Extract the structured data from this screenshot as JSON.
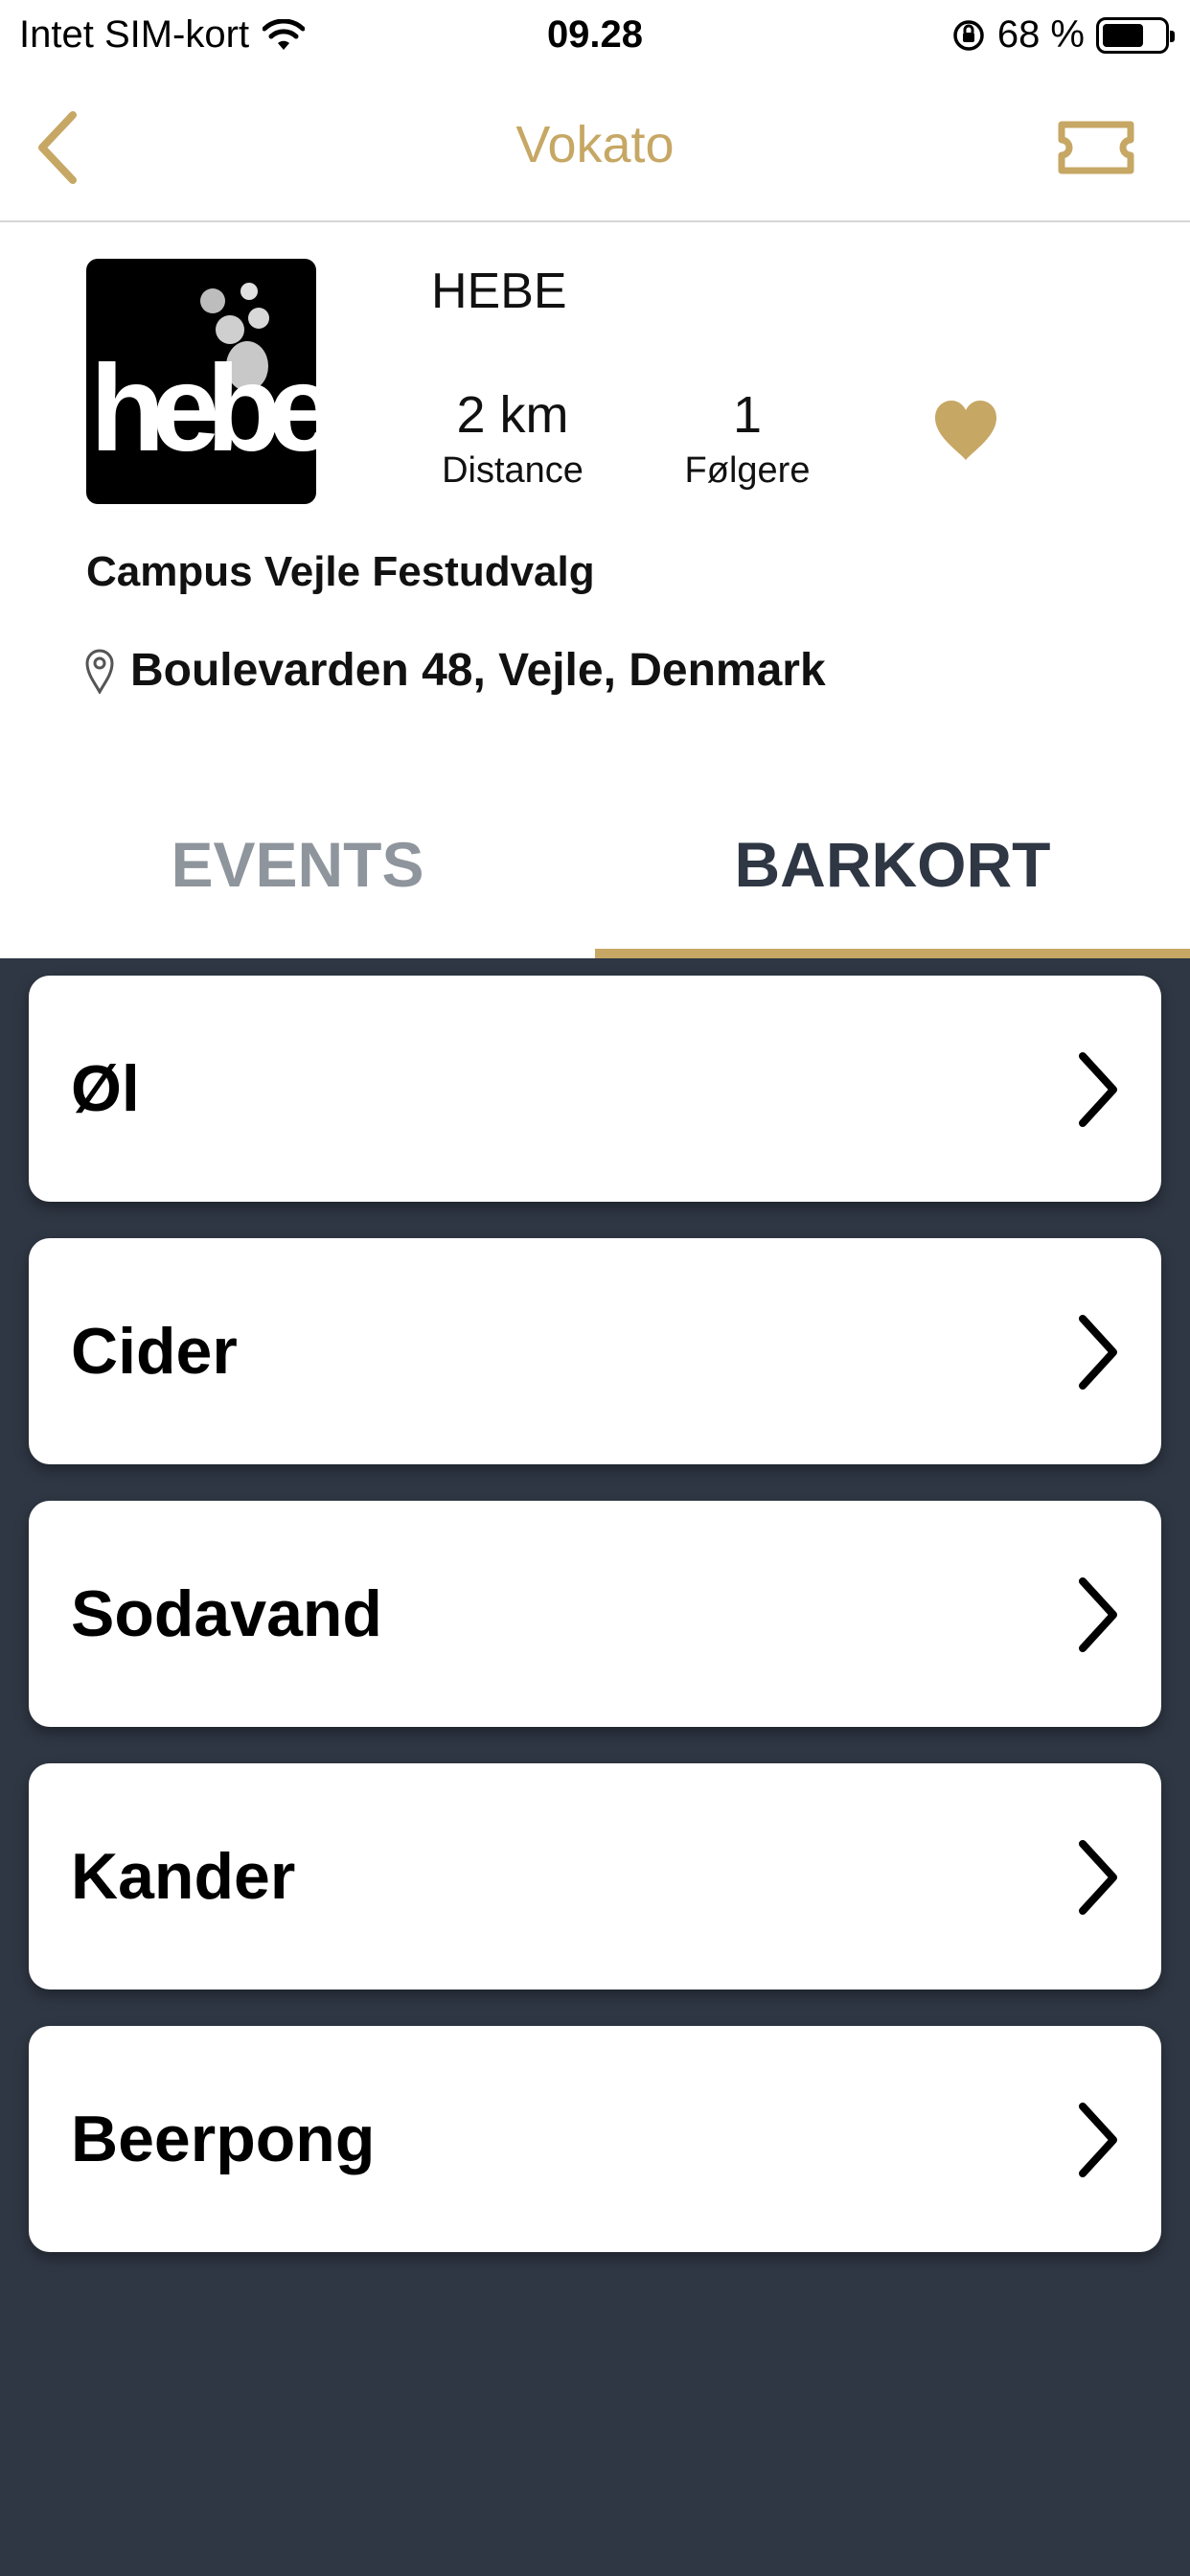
{
  "status_bar": {
    "carrier": "Intet SIM-kort",
    "time": "09.28",
    "battery_percent": "68 %",
    "battery_level": 0.68,
    "icons": [
      "wifi-icon",
      "orientation-lock-icon",
      "battery-icon"
    ]
  },
  "nav": {
    "title": "Vokato",
    "back_icon": "chevron-left-icon",
    "right_icon": "ticket-icon"
  },
  "venue": {
    "logo_text": "hebe",
    "name": "HEBE",
    "distance_value": "2 km",
    "distance_label": "Distance",
    "followers_value": "1",
    "followers_label": "Følgere",
    "organizer": "Campus Vejle Festudvalg",
    "address": "Boulevarden 48, Vejle, Denmark",
    "favorite_icon": "heart-icon"
  },
  "tabs": [
    {
      "label": "EVENTS",
      "active": false
    },
    {
      "label": "BARKORT",
      "active": true
    }
  ],
  "menu_categories": [
    {
      "label": "Øl"
    },
    {
      "label": "Cider"
    },
    {
      "label": "Sodavand"
    },
    {
      "label": "Kander"
    },
    {
      "label": "Beerpong"
    }
  ],
  "colors": {
    "accent_gold": "#c6a764",
    "list_background": "#2f3744",
    "tab_inactive": "#8f959c",
    "tab_active": "#2f3744"
  }
}
